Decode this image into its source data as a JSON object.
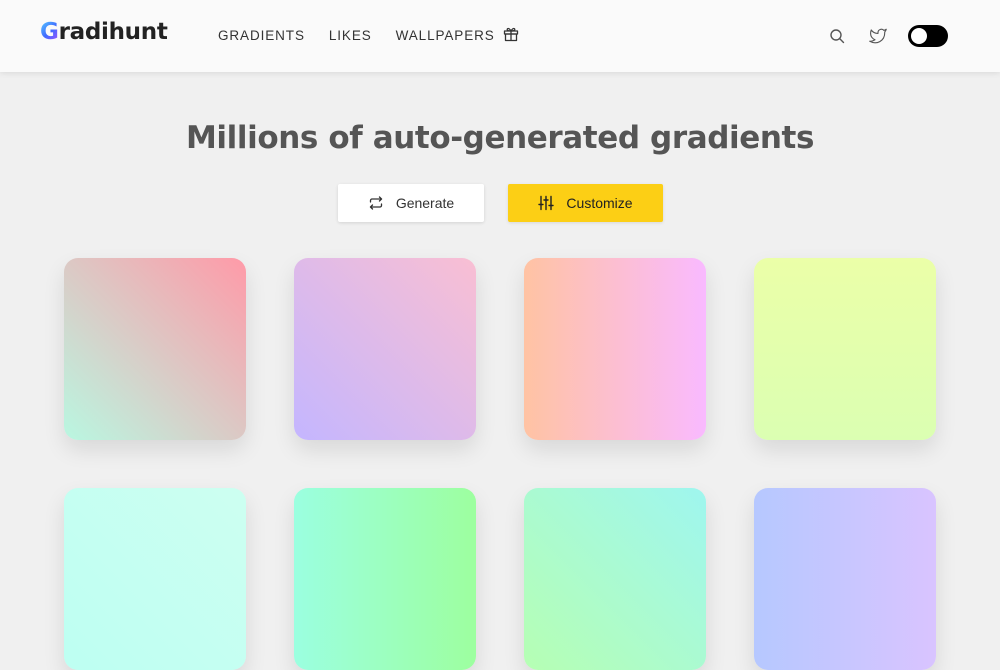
{
  "app": {
    "logo_first": "G",
    "logo_rest": "radihunt"
  },
  "nav": {
    "items": [
      {
        "label": "GRADIENTS"
      },
      {
        "label": "LIKES"
      },
      {
        "label": "WALLPAPERS"
      }
    ],
    "gift_icon": "gift-icon"
  },
  "header_actions": {
    "search_icon": "search-icon",
    "twitter_icon": "twitter-icon",
    "theme_toggle": "dark-mode-toggle"
  },
  "hero": {
    "title": "Millions of auto-generated gradients"
  },
  "buttons": {
    "generate": {
      "label": "Generate",
      "icon": "repeat-icon"
    },
    "customize": {
      "label": "Customize",
      "icon": "sliders-icon",
      "color": "#fccf15"
    }
  },
  "gradients": [
    {
      "angle": "45deg",
      "from": "#b9f7e1",
      "to": "#ff9aa8"
    },
    {
      "angle": "45deg",
      "from": "#c4b6ff",
      "to": "#f9bfd3"
    },
    {
      "angle": "90deg",
      "from": "#ffc3a3",
      "to": "#f9baff"
    },
    {
      "angle": "0deg",
      "from": "#dbffb2",
      "to": "#ebffa8"
    },
    {
      "angle": "45deg",
      "from": "#bdfff2",
      "to": "#cdfff1"
    },
    {
      "angle": "90deg",
      "from": "#9bffe0",
      "to": "#9dff9f"
    },
    {
      "angle": "45deg",
      "from": "#b6ffb3",
      "to": "#9ff6ef"
    },
    {
      "angle": "90deg",
      "from": "#b6c8ff",
      "to": "#d9c4ff"
    }
  ]
}
